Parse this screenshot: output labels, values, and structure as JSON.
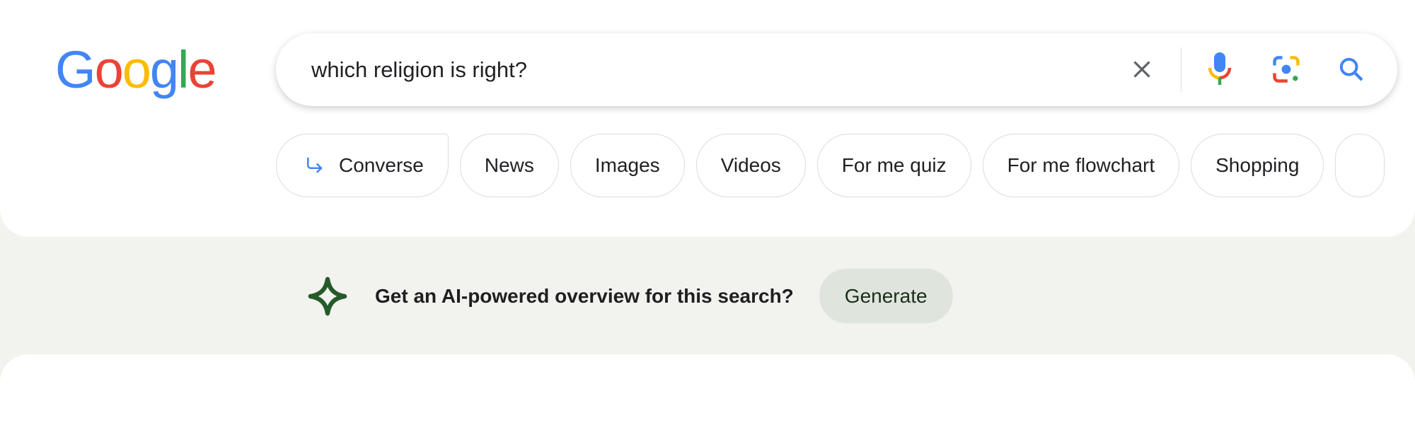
{
  "logo": {
    "text": "Google",
    "letters": [
      "G",
      "o",
      "o",
      "g",
      "l",
      "e"
    ],
    "colors": [
      "#4285f4",
      "#ea4335",
      "#fbbc05",
      "#4285f4",
      "#34a853",
      "#ea4335"
    ]
  },
  "search": {
    "query": "which religion is right?",
    "icons": [
      "close-icon",
      "microphone-icon",
      "google-lens-icon",
      "search-icon"
    ]
  },
  "chips": [
    {
      "label": "Converse",
      "icon": "arrow-return-icon"
    },
    {
      "label": "News"
    },
    {
      "label": "Images"
    },
    {
      "label": "Videos"
    },
    {
      "label": "For me quiz"
    },
    {
      "label": "For me flowchart"
    },
    {
      "label": "Shopping"
    }
  ],
  "ai_overview": {
    "prompt": "Get an AI-powered overview for this search?",
    "button": "Generate",
    "icon": "sparkle-icon",
    "accent": "#255a2b"
  }
}
